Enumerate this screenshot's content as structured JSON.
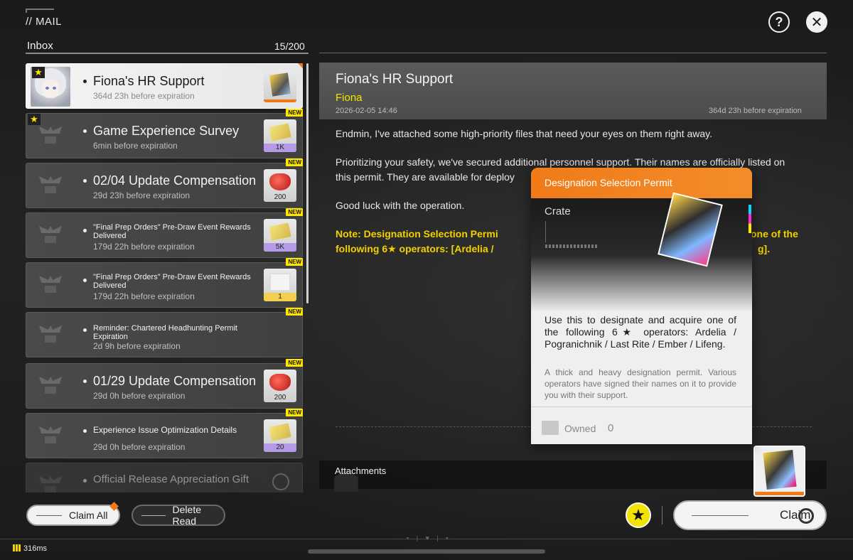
{
  "header": {
    "title": "// MAIL"
  },
  "inbox": {
    "label": "Inbox",
    "count": "15/200"
  },
  "mails": [
    {
      "title": "Fiona's HR Support",
      "expiry": "364d 23h before expiration",
      "reward_qty": "",
      "new": ""
    },
    {
      "title": "Game Experience Survey",
      "expiry": "6min before expiration",
      "reward_qty": "1K",
      "new": "NEW"
    },
    {
      "title": "02/04 Update Compensation",
      "expiry": "29d 23h before expiration",
      "reward_qty": "200",
      "new": "NEW"
    },
    {
      "title": "\"Final Prep Orders\" Pre-Draw Event Rewards Delivered",
      "expiry": "179d 22h before expiration",
      "reward_qty": "5K",
      "new": "NEW"
    },
    {
      "title": "\"Final Prep Orders\" Pre-Draw Event Rewards Delivered",
      "expiry": "179d 22h before expiration",
      "reward_qty": "1",
      "new": "NEW"
    },
    {
      "title": "Reminder: Chartered Headhunting Permit Expiration",
      "expiry": "2d 9h before expiration",
      "reward_qty": "",
      "new": "NEW"
    },
    {
      "title": "01/29 Update Compensation",
      "expiry": "29d 0h before expiration",
      "reward_qty": "200",
      "new": "NEW"
    },
    {
      "title": "Experience Issue Optimization Details",
      "expiry": "29d 0h before expiration",
      "reward_qty": "20",
      "new": "NEW"
    },
    {
      "title": "Official Release Appreciation Gift",
      "expiry": "",
      "reward_qty": "",
      "new": ""
    }
  ],
  "actions": {
    "claim_all": "Claim All",
    "delete_read": "Delete Read",
    "claim": "Claim"
  },
  "detail": {
    "title": "Fiona's HR Support",
    "sender": "Fiona",
    "date": "2026-02-05 14:46",
    "expiry": "364d 23h before expiration",
    "para1": "Endmin, I've attached some high-priority files that need your eyes on them right away.",
    "para2a": "Prioritizing your safety, we've secured additional personnel support. Their names are officially listed on",
    "para2b": "this permit. They are available for deploy",
    "para3": "Good luck with the operation.",
    "note_a": "Note: Designation Selection Permi",
    "note_a2": "one of the",
    "note_b": "following 6★ operators: [Ardelia /",
    "note_b2": "g].",
    "attachments_label": "Attachments"
  },
  "tooltip": {
    "title": "Designation Selection Permit",
    "type": "Crate",
    "description": "Use this to designate and acquire one of the following 6★ operators: Ardelia / Pogranichnik / Last Rite / Ember / Lifeng.",
    "flavor": "A thick and heavy designation permit. Various operators have signed their names on it to provide you with their support.",
    "owned_label": "Owned",
    "owned_value": "0"
  },
  "status": {
    "ping": "316ms"
  },
  "colors": {
    "accent_orange": "#f07a18",
    "accent_yellow": "#f3e300",
    "new_badge": "#ffe600"
  }
}
